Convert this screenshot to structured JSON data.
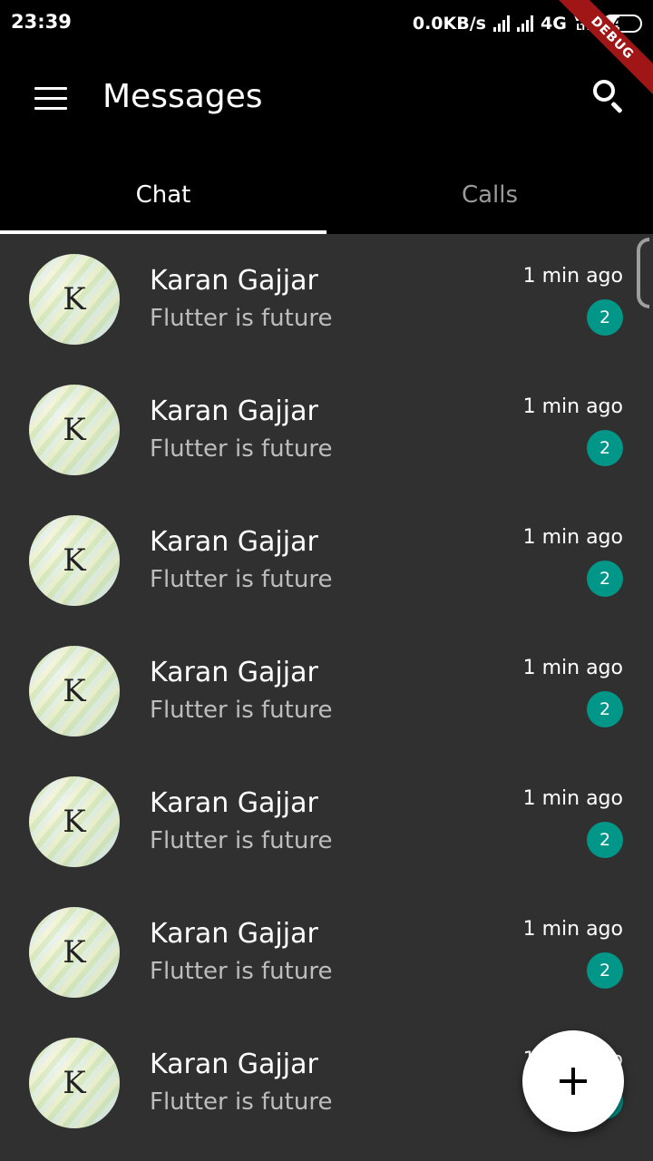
{
  "status_bar": {
    "time": "23:39",
    "network_speed": "0.0KB/s",
    "network_type": "4G",
    "volte_top": "Vo))",
    "volte_bottom": "LTE",
    "battery": "42",
    "battery_level_percent": 42
  },
  "debug_banner": "DEBUG",
  "app_bar": {
    "menu_icon": "menu-icon",
    "title": "Messages",
    "search_icon": "search-icon"
  },
  "tabs": [
    {
      "label": "Chat",
      "active": true
    },
    {
      "label": "Calls",
      "active": false
    }
  ],
  "chats": [
    {
      "initial": "K",
      "name": "Karan Gajjar",
      "message": "Flutter is future",
      "time": "1 min ago",
      "unread": "2"
    },
    {
      "initial": "K",
      "name": "Karan Gajjar",
      "message": "Flutter is future",
      "time": "1 min ago",
      "unread": "2"
    },
    {
      "initial": "K",
      "name": "Karan Gajjar",
      "message": "Flutter is future",
      "time": "1 min ago",
      "unread": "2"
    },
    {
      "initial": "K",
      "name": "Karan Gajjar",
      "message": "Flutter is future",
      "time": "1 min ago",
      "unread": "2"
    },
    {
      "initial": "K",
      "name": "Karan Gajjar",
      "message": "Flutter is future",
      "time": "1 min ago",
      "unread": "2"
    },
    {
      "initial": "K",
      "name": "Karan Gajjar",
      "message": "Flutter is future",
      "time": "1 min ago",
      "unread": "2"
    },
    {
      "initial": "K",
      "name": "Karan Gajjar",
      "message": "Flutter is future",
      "time": "1 min ago",
      "unread": "2"
    }
  ],
  "fab": {
    "icon": "plus-icon"
  },
  "colors": {
    "app_bar": "#000000",
    "background": "#303030",
    "badge": "#009688",
    "secondary_text": "#bdbdbd",
    "debug_banner": "#a01616"
  }
}
